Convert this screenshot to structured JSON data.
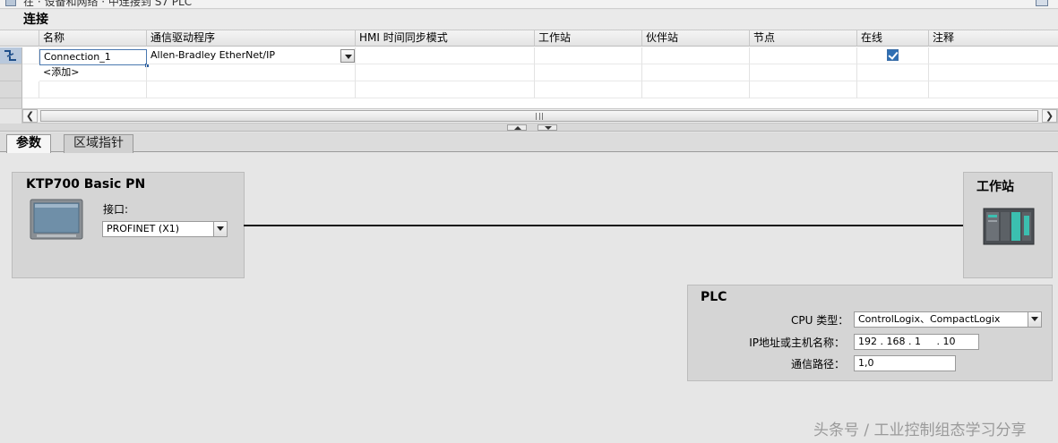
{
  "window": {
    "title": "在 · 设备和网络 · 中连接到 S7 PLC"
  },
  "connections": {
    "section_title": "连接",
    "columns": [
      "名称",
      "通信驱动程序",
      "HMI 时间同步模式",
      "工作站",
      "伙伴站",
      "节点",
      "在线",
      "注释"
    ],
    "sort_column": "通信驱动程序",
    "rows": [
      {
        "name": "Connection_1",
        "driver": "Allen-Bradley EtherNet/IP",
        "hmi_time_sync": "",
        "station": "",
        "partner_station": "",
        "node": "",
        "online": true,
        "comment": ""
      }
    ],
    "add_row_label": "<添加>"
  },
  "tabs": [
    {
      "label": "参数",
      "active": true
    },
    {
      "label": "区域指针",
      "active": false
    }
  ],
  "hmi_device": {
    "title": "KTP700 Basic PN",
    "interface_label": "接口:",
    "interface_value": "PROFINET (X1)"
  },
  "station_device": {
    "title": "工作站"
  },
  "plc": {
    "title": "PLC",
    "cpu_type_label": "CPU 类型：",
    "cpu_type_value": "ControlLogix、CompactLogix",
    "ip_label": "IP地址或主机名称：",
    "ip_value": "192 . 168 . 1     . 10",
    "path_label": "通信路径：",
    "path_value": "1,0"
  },
  "watermark": "头条号 / 工业控制组态学习分享",
  "colors": {
    "selection": "#2f6fb3",
    "panel": "#d5d5d5",
    "background": "#e6e6e6",
    "screen": "#6f8fa8",
    "module_accent": "#3bbfb0"
  }
}
